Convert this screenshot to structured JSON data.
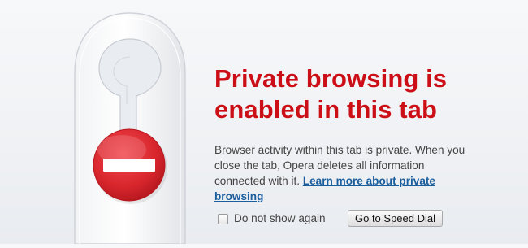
{
  "headline": {
    "line1": "Private browsing is",
    "line2": "enabled in this tab"
  },
  "description": {
    "text": "Browser activity within this tab is private. When you close the tab, Opera deletes all information connected with it. ",
    "link_label": "Learn more about private browsing"
  },
  "options": {
    "do_not_show_label": "Do not show again",
    "do_not_show_checked": false
  },
  "buttons": {
    "speed_dial_label": "Go to Speed Dial"
  },
  "illustration": {
    "hanger_icon": "do-not-disturb-door-hanger-icon",
    "stop_sign_icon": "no-entry-icon",
    "stop_color": "#d9262d"
  },
  "colors": {
    "headline": "#cc0f16",
    "link": "#1a5e9e",
    "text": "#444444"
  }
}
